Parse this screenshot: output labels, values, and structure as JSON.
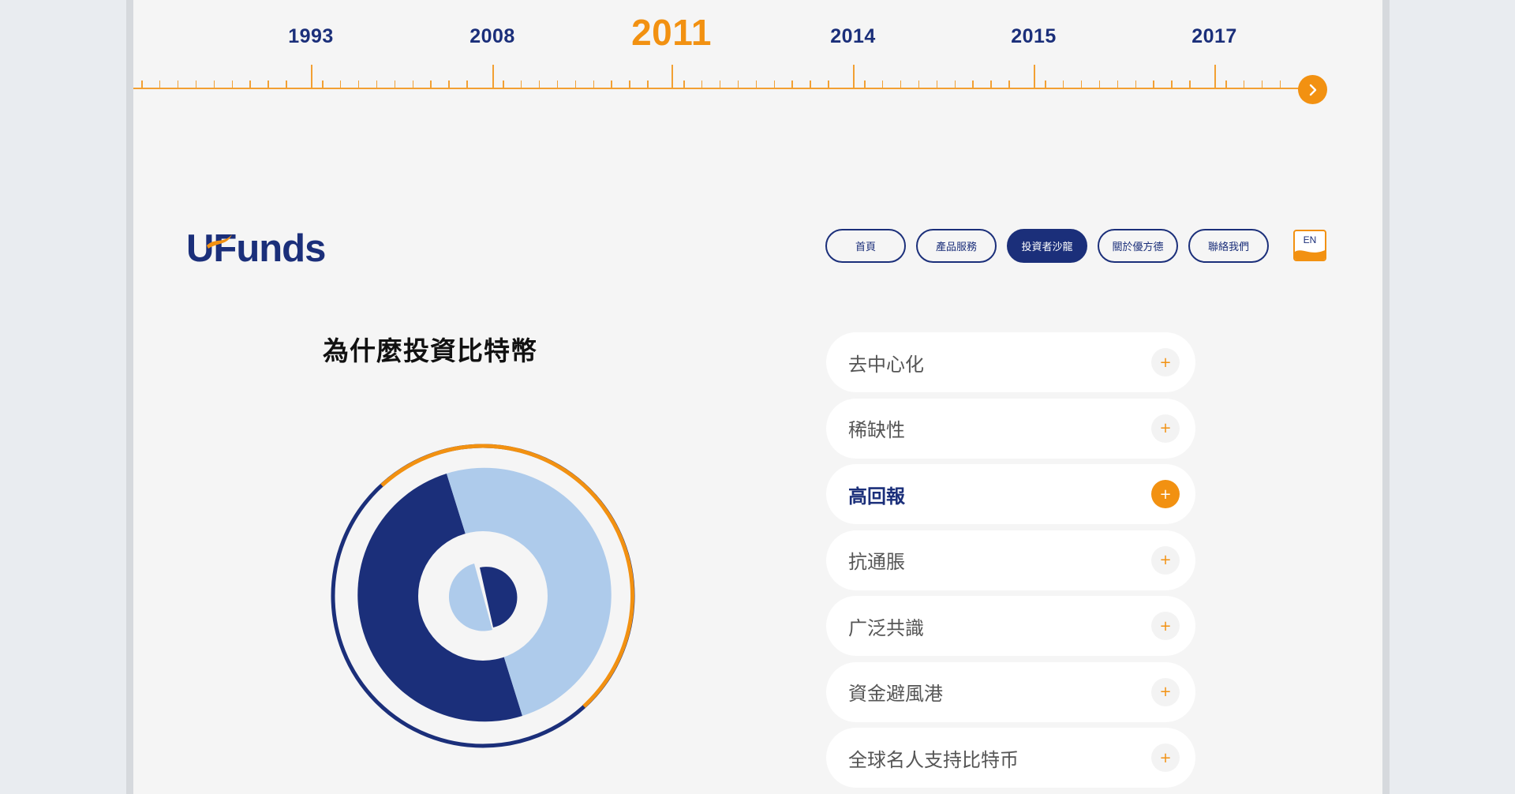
{
  "timeline": {
    "years": [
      {
        "label": "1993",
        "active": false
      },
      {
        "label": "2008",
        "active": false
      },
      {
        "label": "2011",
        "active": true
      },
      {
        "label": "2014",
        "active": false
      },
      {
        "label": "2015",
        "active": false
      },
      {
        "label": "2017",
        "active": false
      }
    ],
    "next_icon": "chevron-right-icon"
  },
  "header": {
    "logo_text": "UFunds",
    "nav": [
      "首頁",
      "產品服務",
      "投資者沙龍",
      "關於優方德",
      "聯絡我們"
    ],
    "active_nav": "投資者沙龍",
    "lang_label": "EN"
  },
  "section": {
    "title": "為什麼投資比特幣"
  },
  "accordion": {
    "items": [
      {
        "label": "去中心化",
        "active": false
      },
      {
        "label": "稀缺性",
        "active": false
      },
      {
        "label": "高回報",
        "active": true
      },
      {
        "label": "抗通脹",
        "active": false
      },
      {
        "label": "广泛共識",
        "active": false
      },
      {
        "label": "資金避風港",
        "active": false
      },
      {
        "label": "全球名人支持比特币",
        "active": false
      }
    ],
    "toggle_symbol": "+"
  },
  "colors": {
    "navy": "#1b2f7a",
    "orange": "#f29111",
    "light_blue": "#aecbeb",
    "background": "#f5f5f5"
  }
}
